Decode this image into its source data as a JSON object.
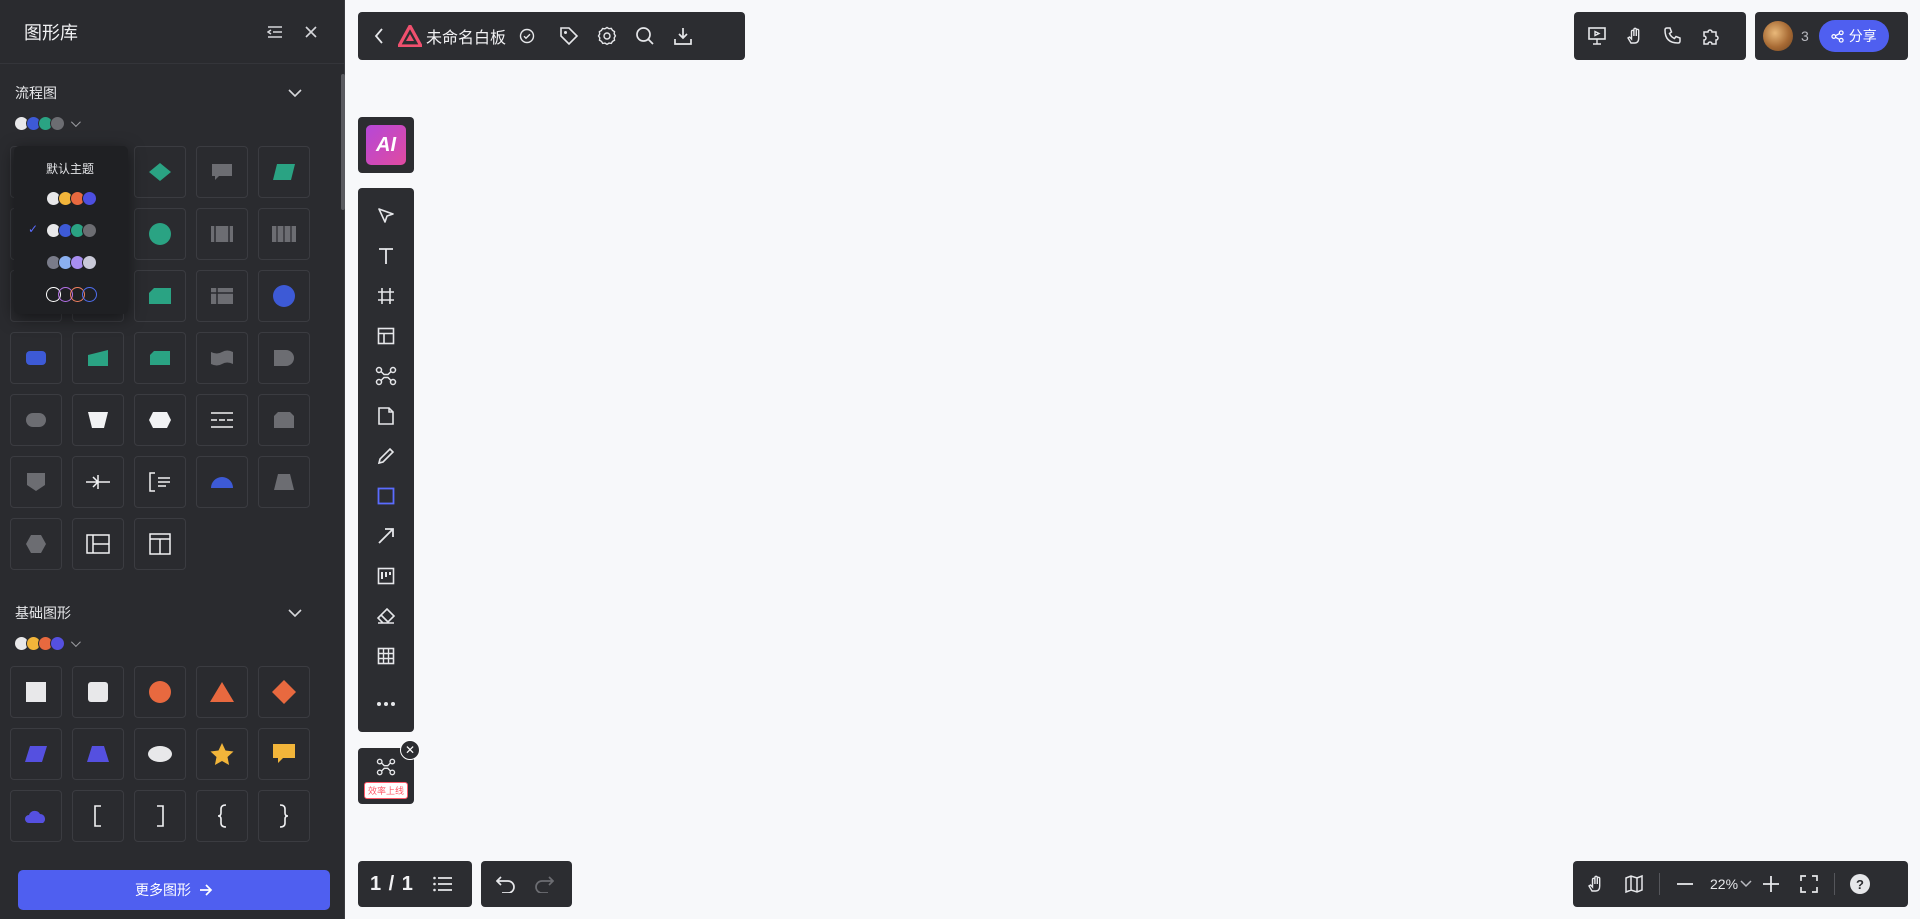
{
  "panel": {
    "title": "图形库",
    "sections": [
      {
        "title": "流程图",
        "theme_colors": [
          "#e8e8ea",
          "#3d5ad6",
          "#2aa383",
          "#6c6d72"
        ]
      },
      {
        "title": "基础图形",
        "theme_colors": [
          "#e8e8ea",
          "#f2b53a",
          "#e8693f",
          "#5550e0"
        ]
      }
    ],
    "more_button": "更多图形"
  },
  "theme_popup": {
    "title": "默认主题",
    "themes": [
      {
        "colors": [
          "#e8e8ea",
          "#f2b53a",
          "#e8693f",
          "#4d4fe0"
        ],
        "selected": false
      },
      {
        "colors": [
          "#e8e8ea",
          "#3d5ad6",
          "#2aa383",
          "#6c6d72"
        ],
        "selected": true
      },
      {
        "colors": [
          "#7a7c8a",
          "#8bb0f0",
          "#a88ef0",
          "#c9c9d8"
        ],
        "selected": false
      },
      {
        "colors": [
          "#ffffff",
          "#b570e8",
          "#f08060",
          "#4f6ef0"
        ],
        "selected": false
      }
    ]
  },
  "header": {
    "doc_title": "未命名白板",
    "brand_color": "#f0506e"
  },
  "collab": {
    "count": "3",
    "share_label": "分享"
  },
  "toolbar": {
    "ai_label": "AI",
    "mini_badge": "效率上线"
  },
  "footer": {
    "page_indicator": "1 / 1",
    "zoom": "22%"
  },
  "colors": {
    "accent": "#4f5ff0",
    "panel_bg": "#2a2b2f",
    "canvas_bg": "#f7f8fa"
  }
}
